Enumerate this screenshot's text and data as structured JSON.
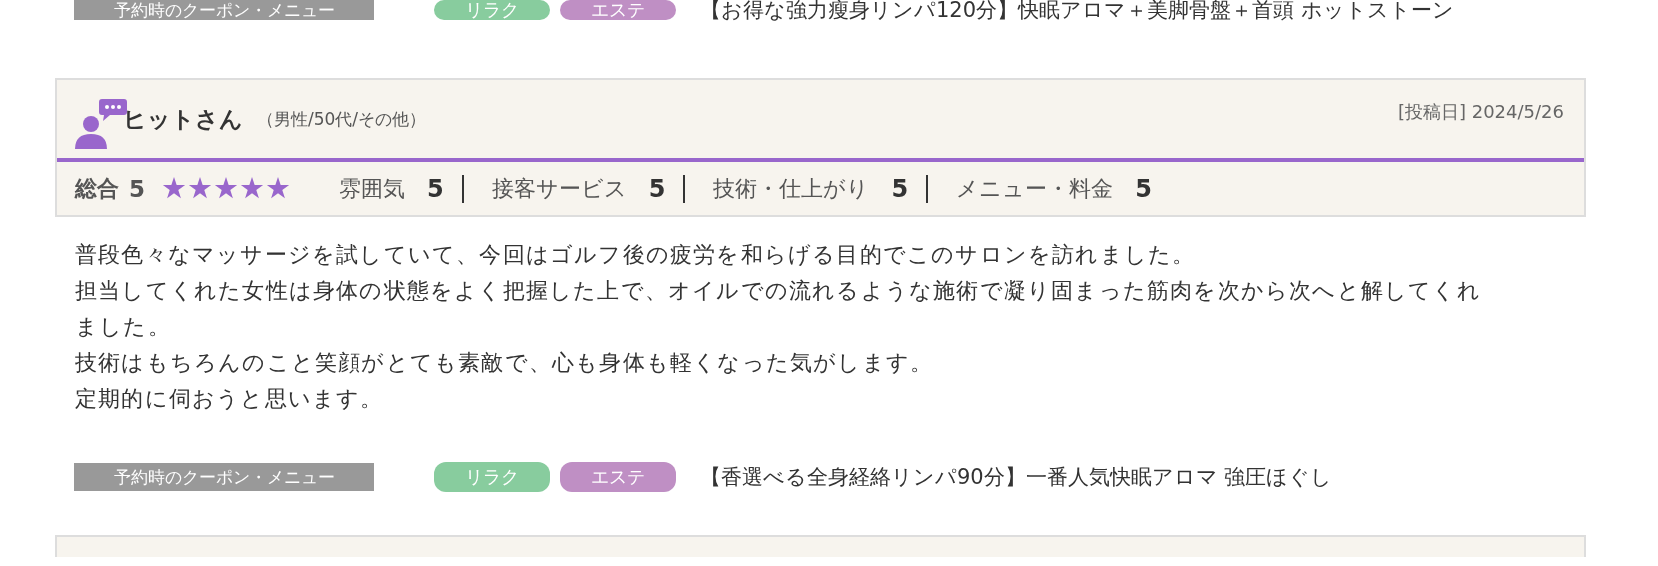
{
  "previous_coupon": {
    "label": "予約時のクーポン・メニュー",
    "tags": [
      {
        "text": "リラク",
        "color": "#88cc9e"
      },
      {
        "text": "エステ",
        "color": "#bf8fc4"
      }
    ],
    "menu": "【お得な強力瘦身リンパ120分】快眠アロマ＋美脚骨盤＋首頭 ホットストーン"
  },
  "review": {
    "reviewer": "ヒットさん",
    "profile": "（男性/50代/その他）",
    "posted": "[投稿日] 2024/5/26",
    "overall_label": "総合",
    "overall_score": "5",
    "stars": 5,
    "ratings": [
      {
        "label": "雰囲気",
        "score": "5"
      },
      {
        "label": "接客サービス",
        "score": "5"
      },
      {
        "label": "技術・仕上がり",
        "score": "5"
      },
      {
        "label": "メニュー・料金",
        "score": "5"
      }
    ],
    "body": [
      "普段色々なマッサージを試していて、今回はゴルフ後の疲労を和らげる目的でこのサロンを訪れました。",
      "担当してくれた女性は身体の状態をよく把握した上で、オイルでの流れるような施術で凝り固まった筋肉を次から次へと解してくれました。",
      "技術はもちろんのこと笑顔がとても素敵で、心も身体も軽くなった気がします。",
      "定期的に伺おうと思います。"
    ],
    "coupon": {
      "label": "予約時のクーポン・メニュー",
      "tags": [
        {
          "text": "リラク",
          "color": "#88cc9e"
        },
        {
          "text": "エステ",
          "color": "#bf8fc4"
        }
      ],
      "menu": "【香選べる全身経絡リンパ90分】一番人気快眠アロマ  強圧ほぐし"
    }
  }
}
